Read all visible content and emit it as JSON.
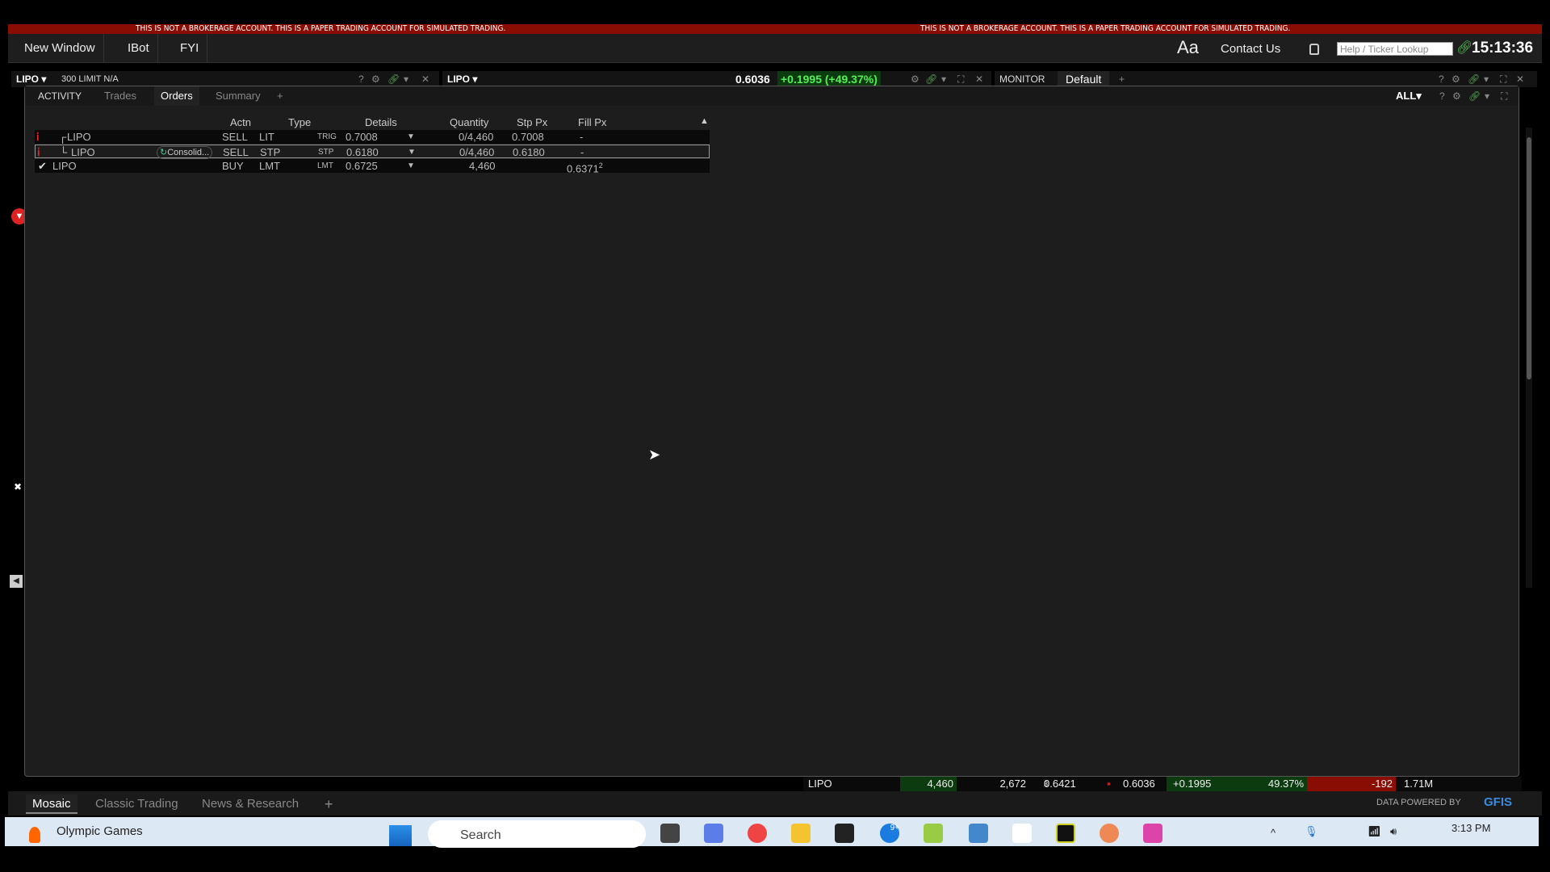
{
  "banner": {
    "text": "THIS IS NOT A BROKERAGE ACCOUNT. THIS IS A PAPER TRADING ACCOUNT FOR SIMULATED TRADING.",
    "color": "#8a0d04"
  },
  "menu": {
    "items": [
      "New Window",
      "IBot",
      "FYI"
    ],
    "font_label": "Aa",
    "contact": "Contact Us",
    "lookup_placeholder": "Help / Ticker Lookup",
    "clock": "15:13:36"
  },
  "panel1": {
    "symbol": "LIPO",
    "order_info": "300 LIMIT N/A"
  },
  "panel2": {
    "symbol": "LIPO",
    "last": "0.6036",
    "change": "+0.1995 (+49.37%)"
  },
  "panel3": {
    "tabs": [
      "MONITOR",
      "Default"
    ]
  },
  "orders": {
    "tabs": [
      "ACTIVITY",
      "Trades",
      "Orders",
      "Summary"
    ],
    "active_tab": "Orders",
    "filter": "ALL",
    "columns": [
      "Actn",
      "Type",
      "Details",
      "Quantity",
      "Stp Px",
      "Fill Px"
    ],
    "rows": [
      {
        "symbol": "LIPO",
        "action": "SELL",
        "type": "LIT",
        "detail_prefix": "TRIG",
        "detail": "0.7008",
        "quantity": "0/4,460",
        "stp_px": "0.7008",
        "fill_px": "-"
      },
      {
        "symbol": "LIPO",
        "status": "Consolid...",
        "action": "SELL",
        "type": "STP",
        "detail_prefix": "STP",
        "detail": "0.6180",
        "quantity": "0/4,460",
        "stp_px": "0.6180",
        "fill_px": "-"
      },
      {
        "symbol": "LIPO",
        "action": "BUY",
        "type": "LMT",
        "detail_prefix": "LMT",
        "detail": "0.6725",
        "quantity": "4,460",
        "stp_px": "",
        "fill_px": "0.6371",
        "fill_sup": "2"
      }
    ]
  },
  "ticker": {
    "symbol": "LIPO",
    "position": "4,460",
    "v2": "2,672",
    "avg": "0.6421",
    "avg_sup": "3",
    "last": "0.6036",
    "change": "+0.1995",
    "pct": "49.37%",
    "pnl": "-192",
    "volume": "1.71M"
  },
  "bottom_tabs": [
    "Mosaic",
    "Classic Trading",
    "News & Research"
  ],
  "data_powered": "DATA POWERED BY",
  "gfis": "GFIS",
  "taskbar": {
    "news": "Olympic Games",
    "search": "Search",
    "time": "3:13 PM",
    "badge": "9+"
  }
}
